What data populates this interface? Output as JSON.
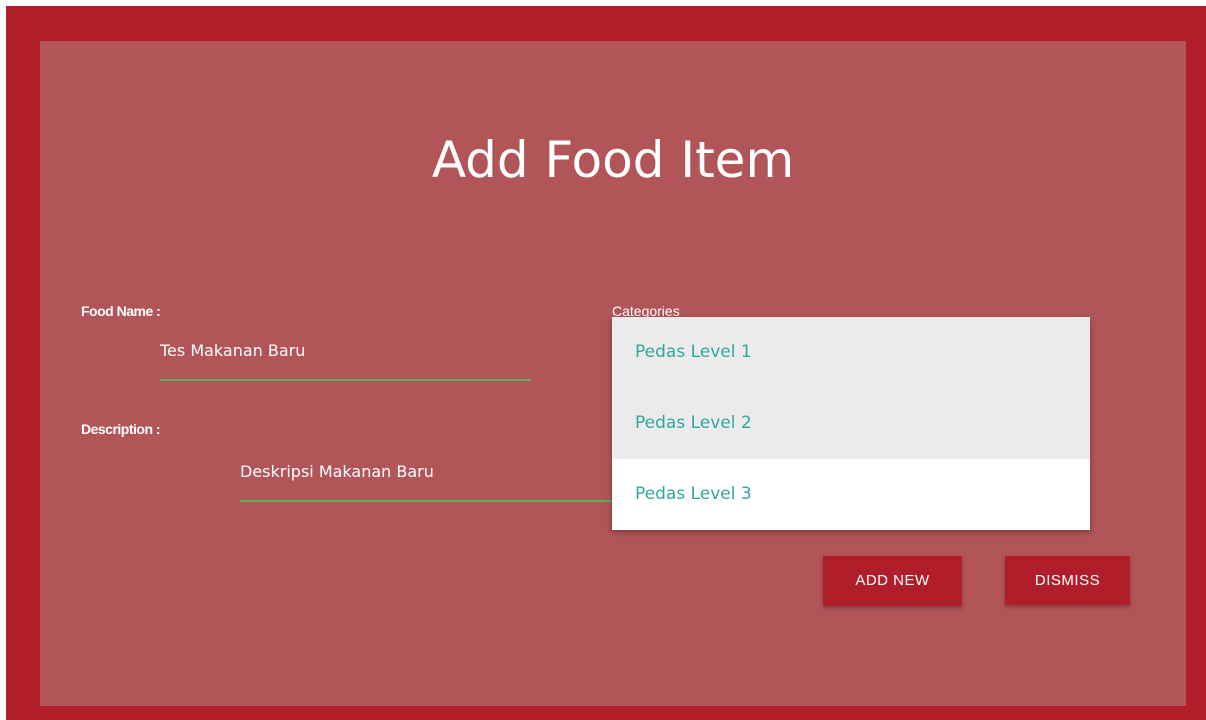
{
  "form": {
    "title": "Add Food Item",
    "food_name_label": "Food Name :",
    "food_name_value": "Tes Makanan Baru",
    "description_label": "Description :",
    "description_value": "Deskripsi Makanan Baru",
    "categories_label": "Categories"
  },
  "categories_dropdown": {
    "options": [
      "Pedas Level 1",
      "Pedas Level 2",
      "Pedas Level 3"
    ],
    "highlighted": [
      "Pedas Level 1",
      "Pedas Level 2"
    ]
  },
  "buttons": {
    "add_label": "ADD NEW",
    "dismiss_label": "DISMISS"
  },
  "colors": {
    "frame": "#b01f29",
    "panel": "#b25559",
    "underline": "#55b15c",
    "option_text": "#31a79a",
    "option_highlight": "#ebebeb"
  }
}
